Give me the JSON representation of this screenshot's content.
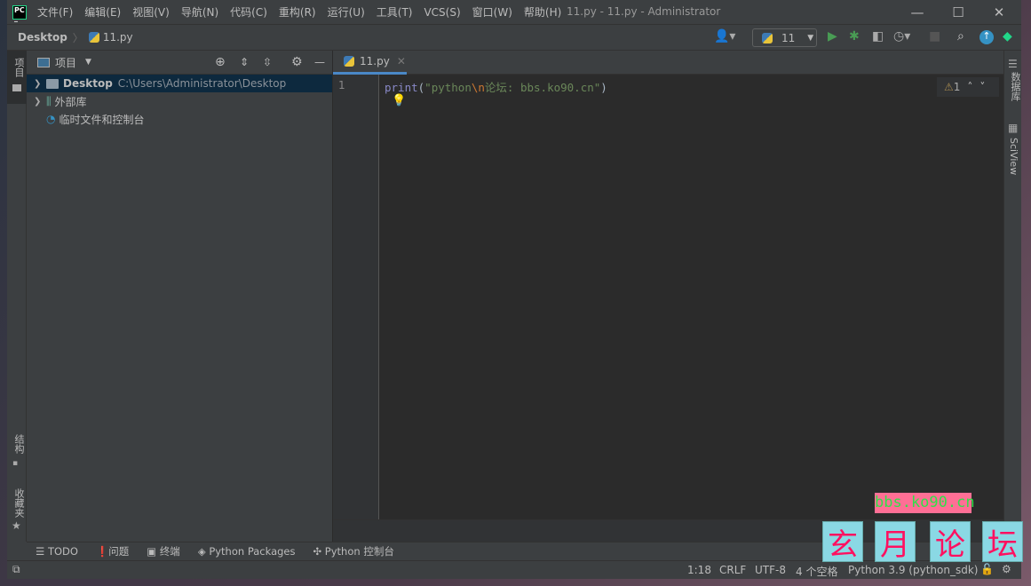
{
  "menu": [
    "文件(F)",
    "编辑(E)",
    "视图(V)",
    "导航(N)",
    "代码(C)",
    "重构(R)",
    "运行(U)",
    "工具(T)",
    "VCS(S)",
    "窗口(W)",
    "帮助(H)"
  ],
  "window_title": "11.py - 11.py - Administrator",
  "breadcrumb": {
    "folder": "Desktop",
    "file": "11.py"
  },
  "run_config": "11",
  "left_strip": {
    "project": "项目",
    "structure": "结构",
    "favorites": "收藏夹"
  },
  "right_strip": {
    "database": "数据库",
    "sciview": "SciView"
  },
  "project_panel": {
    "title": "项目",
    "tree": [
      {
        "name": "Desktop",
        "path": "C:\\Users\\Administrator\\Desktop"
      },
      {
        "name": "外部库"
      },
      {
        "name": "临时文件和控制台"
      }
    ]
  },
  "editor": {
    "tab": "11.py",
    "line_number": "1",
    "code_fn": "print",
    "code_paren_open": "(",
    "code_str1": "\"python",
    "code_escape": "\\n",
    "code_str2": "论坛: bbs.ko90.cn\"",
    "code_paren_close": ")",
    "warnings": "1"
  },
  "bottom_tabs": [
    "TODO",
    "问题",
    "终端",
    "Python Packages",
    "Python 控制台"
  ],
  "status": {
    "position": "1:18",
    "line_sep": "CRLF",
    "encoding": "UTF-8",
    "indent": "4 个空格",
    "interpreter": "Python 3.9 (python_sdk)"
  },
  "watermark": {
    "url": "bbs.ko90.cn",
    "chars": [
      "玄",
      "月",
      "论",
      "坛"
    ]
  },
  "colors": {
    "accent": "#4a88c7",
    "run": "#499c54",
    "string": "#6a8759",
    "keyword": "#8888c6"
  }
}
